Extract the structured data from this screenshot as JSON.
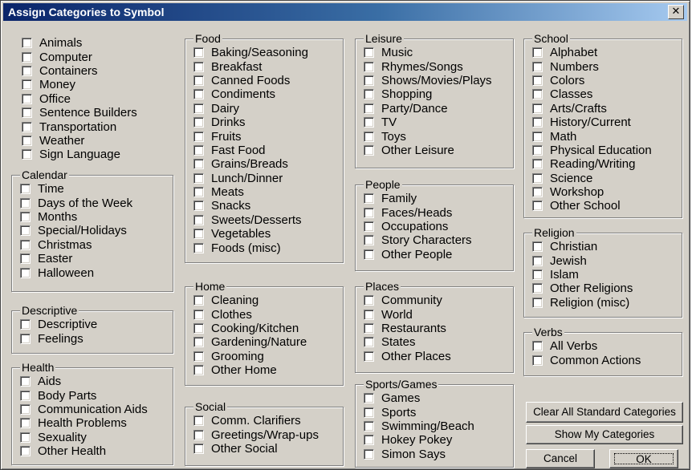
{
  "window": {
    "title": "Assign Categories to Symbol"
  },
  "ungrouped": [
    "Animals",
    "Computer",
    "Containers",
    "Money",
    "Office",
    "Sentence Builders",
    "Transportation",
    "Weather",
    "Sign Language"
  ],
  "groups": {
    "calendar": {
      "title": "Calendar",
      "items": [
        "Time",
        "Days of the Week",
        "Months",
        "Special/Holidays",
        "Christmas",
        "Easter",
        "Halloween"
      ]
    },
    "descriptive": {
      "title": "Descriptive",
      "items": [
        "Descriptive",
        "Feelings"
      ]
    },
    "health": {
      "title": "Health",
      "items": [
        "Aids",
        "Body Parts",
        "Communication Aids",
        "Health Problems",
        "Sexuality",
        "Other Health"
      ]
    },
    "food": {
      "title": "Food",
      "items": [
        "Baking/Seasoning",
        "Breakfast",
        "Canned Foods",
        "Condiments",
        "Dairy",
        "Drinks",
        "Fruits",
        "Fast Food",
        "Grains/Breads",
        "Lunch/Dinner",
        "Meats",
        "Snacks",
        "Sweets/Desserts",
        "Vegetables",
        "Foods (misc)"
      ]
    },
    "home": {
      "title": "Home",
      "items": [
        "Cleaning",
        "Clothes",
        "Cooking/Kitchen",
        "Gardening/Nature",
        "Grooming",
        "Other Home"
      ]
    },
    "social": {
      "title": "Social",
      "items": [
        "Comm. Clarifiers",
        "Greetings/Wrap-ups",
        "Other Social"
      ]
    },
    "leisure": {
      "title": "Leisure",
      "items": [
        "Music",
        "Rhymes/Songs",
        "Shows/Movies/Plays",
        "Shopping",
        "Party/Dance",
        "TV",
        "Toys",
        "Other Leisure"
      ]
    },
    "people": {
      "title": "People",
      "items": [
        "Family",
        "Faces/Heads",
        "Occupations",
        "Story Characters",
        "Other People"
      ]
    },
    "places": {
      "title": "Places",
      "items": [
        "Community",
        "World",
        "Restaurants",
        "States",
        "Other Places"
      ]
    },
    "sports": {
      "title": "Sports/Games",
      "items": [
        "Games",
        "Sports",
        "Swimming/Beach",
        "Hokey Pokey",
        "Simon Says"
      ]
    },
    "school": {
      "title": "School",
      "items": [
        "Alphabet",
        "Numbers",
        "Colors",
        "Classes",
        "Arts/Crafts",
        "History/Current",
        "Math",
        "Physical Education",
        "Reading/Writing",
        "Science",
        "Workshop",
        "Other School"
      ]
    },
    "religion": {
      "title": "Religion",
      "items": [
        "Christian",
        "Jewish",
        "Islam",
        "Other Religions",
        "Religion (misc)"
      ]
    },
    "verbs": {
      "title": "Verbs",
      "items": [
        "All Verbs",
        "Common Actions"
      ]
    }
  },
  "buttons": {
    "clear_all": "Clear All Standard Categories",
    "show_my": "Show My Categories",
    "cancel": "Cancel",
    "ok": "OK"
  },
  "colors": {
    "titlebar_start": "#0a246a",
    "titlebar_end": "#a6caf0",
    "face": "#d4d0c8"
  }
}
